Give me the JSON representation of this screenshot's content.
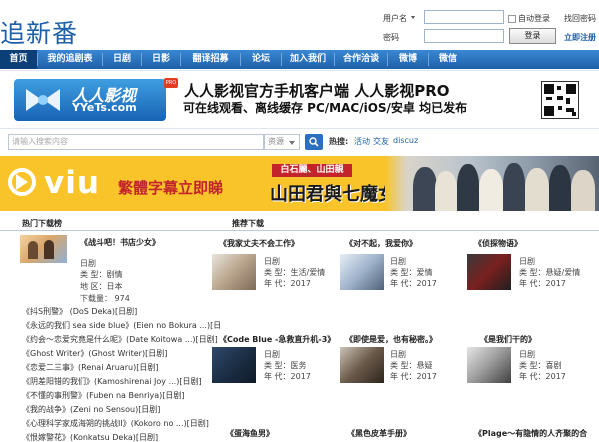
{
  "header": {
    "logo": "追新番",
    "username_label": "用户名",
    "password_label": "密码",
    "auto_login": "自动登录",
    "forgot_password": "找回密码",
    "login_button": "登录",
    "register": "立即注册"
  },
  "nav": {
    "items": [
      {
        "label": "首页",
        "active": true
      },
      {
        "label": "我的追剧表",
        "active": false
      },
      {
        "label": "日剧",
        "active": false
      },
      {
        "label": "日影",
        "active": false
      },
      {
        "label": "翻译招募",
        "active": false
      },
      {
        "label": "论坛",
        "active": false
      },
      {
        "label": "加入我们",
        "active": false
      },
      {
        "label": "合作洽谈",
        "active": false
      },
      {
        "label": "微博",
        "active": false
      },
      {
        "label": "微信",
        "active": false
      }
    ]
  },
  "banner_yyets": {
    "logo_cn": "人人影视",
    "logo_en": "YYeTs.com",
    "badge": "PRO",
    "line1": "人人影视官方手机客户端 人人影视PRO",
    "line2": "可在线观看、离线缓存  PC/MAC/iOS/安卓 均已发布"
  },
  "search": {
    "placeholder": "请输入搜索内容",
    "type_value": "资源",
    "hot_label": "热搜:",
    "hot_links": [
      "活动",
      "交友",
      "discuz"
    ]
  },
  "banner_viu": {
    "brand": "viu",
    "slogan": "繁體字幕立即睇",
    "cast": "白石麗、山田親",
    "title": "山田君與七魔女"
  },
  "left": {
    "heading": "热门下载榜",
    "featured": {
      "title": "《战斗吧！书店少女》",
      "category": "日剧",
      "type": "类 型：剧情",
      "region": "地 区：日本",
      "downloads": "下载量： 974"
    },
    "items": [
      "《抖S刑警》 (DoS Deka)[日剧]",
      "《永远的我们 sea side blue》(Eien no Bokura ...)[日",
      "《约会～恋爱究竟是什么呢》(Date Koitowa ...)[日剧]",
      "《Ghost Writer》(Ghost Writer)[日剧]",
      "《恋爱二三事》(Renai Aruaru)[日剧]",
      "《阴差阳错的我们》(Kamoshirenai Joy ...)[日剧]",
      "《不懂的事刑警》(Fuben na Benriya)[日剧]",
      "《我的战争》(Zeni no Sensou)[日剧]",
      "《心理科学家成海朔的挑战II》(Kokoro no ...)[日剧]",
      "《恨嫁警花》(Konkatsu Deka)[日剧]",
      "《死神》(Moshirue)[日剧]"
    ]
  },
  "right": {
    "heading": "推荐下载",
    "cards": [
      {
        "title": "《我家丈夫不会工作》",
        "category": "日剧",
        "type": "类 型：生活/爱情",
        "year": "年 代：2017"
      },
      {
        "title": "《对不起，我爱你》",
        "category": "日剧",
        "type": "类 型：爱情",
        "year": "年 代：2017"
      },
      {
        "title": "《侦探物语》",
        "category": "日剧",
        "type": "类 型：悬疑/爱情",
        "year": "年 代：2017"
      },
      {
        "title": "《Code Blue -急救直升机-3》",
        "category": "日剧",
        "type": "类 型：医务",
        "year": "年 代：2017"
      },
      {
        "title": "《即使是爱，也有秘密。》",
        "category": "日剧",
        "type": "类 型：悬疑",
        "year": "年 代：2017"
      },
      {
        "title": "《是我们干的》",
        "category": "日剧",
        "type": "类 型：喜剧",
        "year": "年 代：2017"
      },
      {
        "title": "《蛋海鱼男》",
        "category": "",
        "type": "",
        "year": ""
      },
      {
        "title": "《黑色皮革手册》",
        "category": "",
        "type": "",
        "year": ""
      },
      {
        "title": "《Plage～有隐情的人齐聚的合",
        "category": "",
        "type": "",
        "year": ""
      }
    ]
  }
}
